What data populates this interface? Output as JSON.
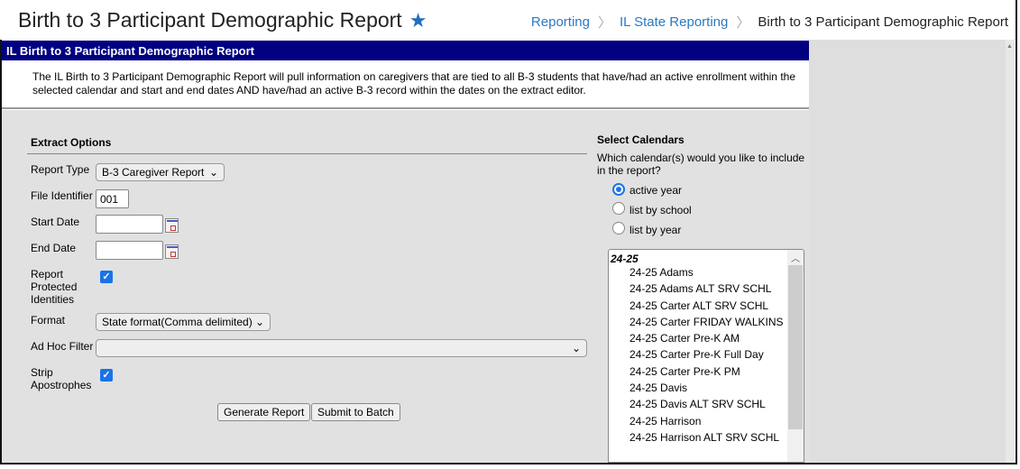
{
  "header": {
    "title": "Birth to 3 Participant Demographic Report",
    "favorite_icon": "star-icon",
    "breadcrumbs": [
      "Reporting",
      "IL State Reporting",
      "Birth to 3 Participant Demographic Report"
    ]
  },
  "banner": {
    "title": "IL Birth to 3 Participant Demographic Report",
    "description": "The IL Birth to 3 Participant Demographic Report will pull information on caregivers that are tied to all B-3 students that have/had an active enrollment within the selected calendar and start and end dates AND have/had an active B-3 record within the dates on the extract editor.",
    "color": "#000080"
  },
  "extract": {
    "heading": "Extract Options",
    "report_type": {
      "label": "Report Type",
      "value": "B-3 Caregiver Report"
    },
    "file_identifier": {
      "label": "File Identifier",
      "value": "001"
    },
    "start_date": {
      "label": "Start Date",
      "value": ""
    },
    "end_date": {
      "label": "End Date",
      "value": ""
    },
    "protected": {
      "label": "Report Protected Identities",
      "checked": true
    },
    "format": {
      "label": "Format",
      "value": "State format(Comma delimited)"
    },
    "adhoc": {
      "label": "Ad Hoc Filter",
      "value": ""
    },
    "strip": {
      "label": "Strip Apostrophes",
      "checked": true
    },
    "generate_label": "Generate Report",
    "batch_label": "Submit to Batch"
  },
  "calendars": {
    "heading": "Select Calendars",
    "question": "Which calendar(s) would you like to include in the report?",
    "options": [
      {
        "label": "active year",
        "selected": true
      },
      {
        "label": "list by school",
        "selected": false
      },
      {
        "label": "list by year",
        "selected": false
      }
    ],
    "group": "24-25",
    "items": [
      "24-25 Adams",
      "24-25 Adams ALT SRV SCHL",
      "24-25 Carter ALT SRV SCHL",
      "24-25 Carter FRIDAY WALKINS",
      "24-25 Carter Pre-K AM",
      "24-25 Carter Pre-K Full Day",
      "24-25 Carter Pre-K PM",
      "24-25 Davis",
      "24-25 Davis ALT SRV SCHL",
      "24-25 Harrison",
      "24-25 Harrison ALT SRV SCHL"
    ]
  }
}
